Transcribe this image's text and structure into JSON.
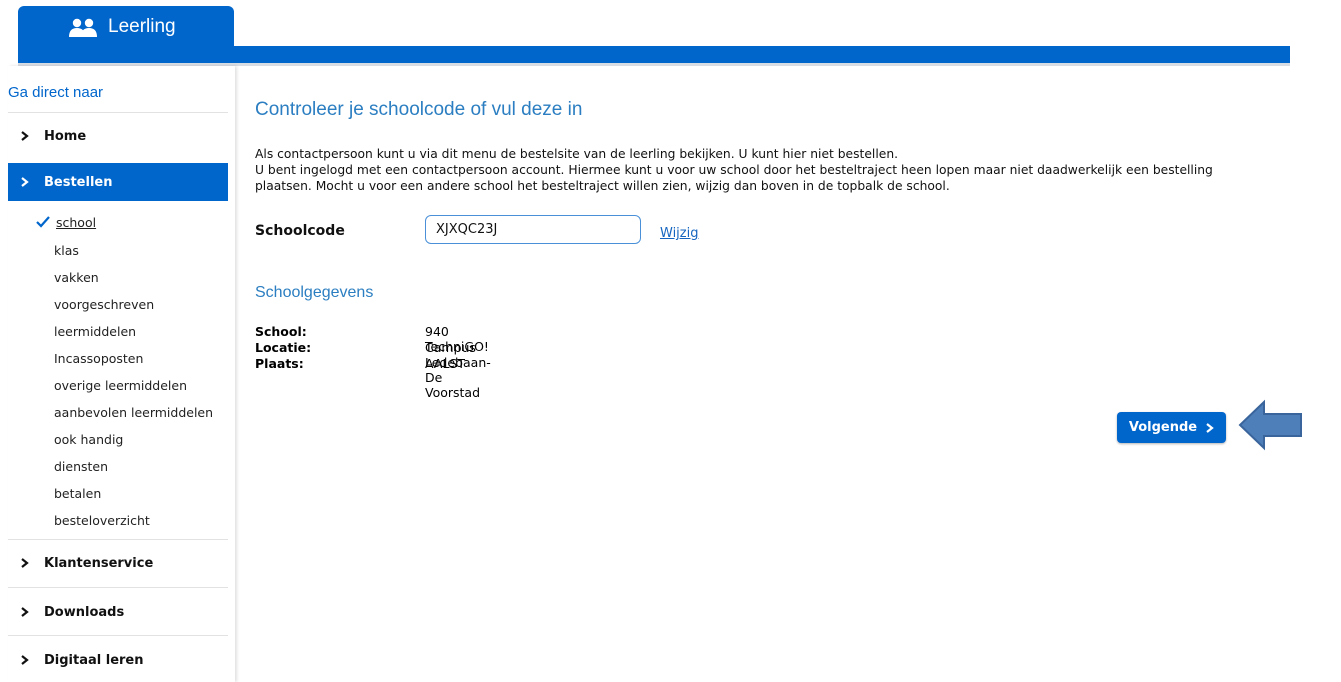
{
  "header": {
    "tab_label": "Leerling"
  },
  "sidebar": {
    "goto_label": "Ga direct naar",
    "items": [
      {
        "label": "Home"
      },
      {
        "label": "Bestellen"
      },
      {
        "label": "Klantenservice"
      },
      {
        "label": "Downloads"
      },
      {
        "label": "Digitaal leren"
      }
    ],
    "subitems": [
      {
        "label": "school"
      },
      {
        "label": "klas"
      },
      {
        "label": "vakken"
      },
      {
        "label": "voorgeschreven"
      },
      {
        "label": "leermiddelen"
      },
      {
        "label": "Incassoposten"
      },
      {
        "label": "overige leermiddelen"
      },
      {
        "label": "aanbevolen leermiddelen"
      },
      {
        "label": "ook handig"
      },
      {
        "label": "diensten"
      },
      {
        "label": "betalen"
      },
      {
        "label": "besteloverzicht"
      }
    ]
  },
  "main": {
    "title": "Controleer je schoolcode of vul deze in",
    "intro_1": "Als contactpersoon kunt u via dit menu de bestelsite van de leerling bekijken. U kunt hier niet bestellen.",
    "intro_2": "U bent ingelogd met een contactpersoon account. Hiermee kunt u voor uw school door het besteltraject heen lopen maar niet daadwerkelijk een bestelling plaatsen. Mocht u voor een andere school het besteltraject willen zien, wijzig dan boven in de topbalk de school.",
    "schoolcode_label": "Schoolcode",
    "schoolcode_value": "XJXQC23J",
    "change_link": "Wijzig",
    "section_title": "Schoolgegevens",
    "details": [
      {
        "key": "School:",
        "value": "940 TechniGO!"
      },
      {
        "key": "Locatie:",
        "value": "Campus Ledebaan- De Voorstad"
      },
      {
        "key": "Plaats:",
        "value": "AALST"
      }
    ],
    "next_button": "Volgende"
  },
  "colors": {
    "brand_blue": "#0066cc",
    "heading_blue": "#2b7ec1",
    "arrow_blue": "#4f7fb9"
  }
}
